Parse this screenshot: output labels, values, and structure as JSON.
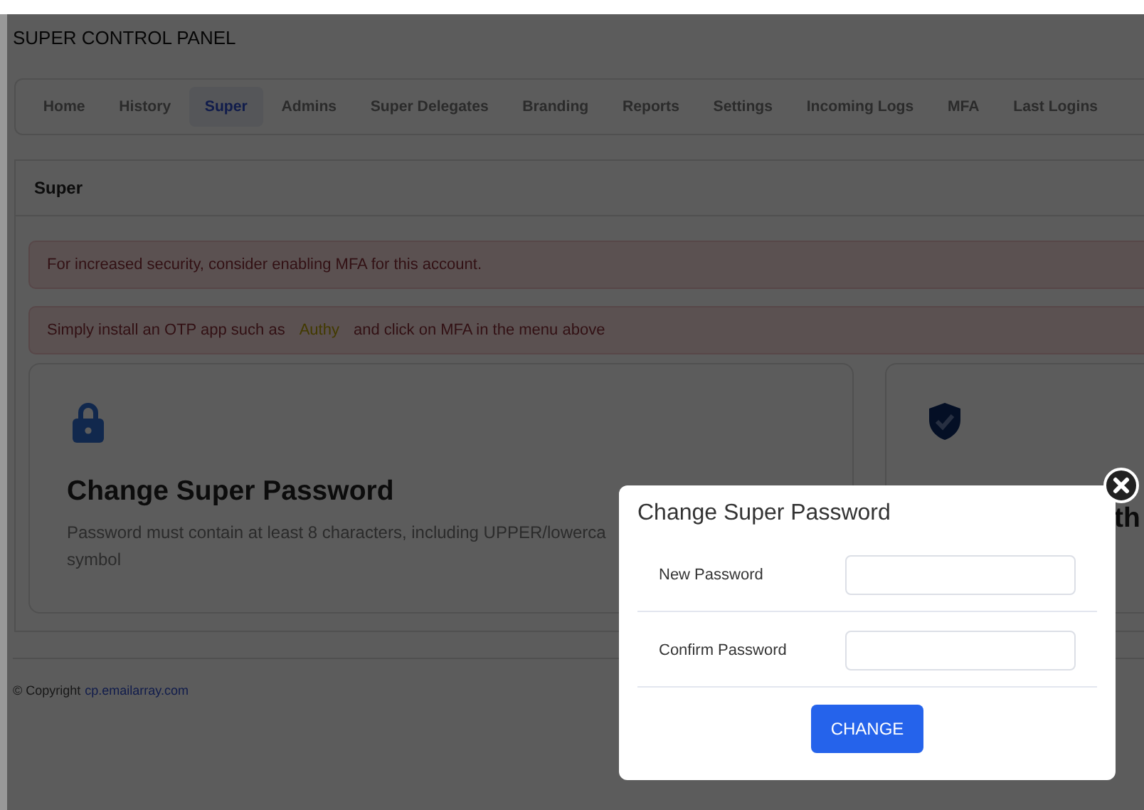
{
  "header": {
    "title": "SUPER CONTROL PANEL"
  },
  "tabs": [
    {
      "label": "Home",
      "selected": false
    },
    {
      "label": "History",
      "selected": false
    },
    {
      "label": "Super",
      "selected": true
    },
    {
      "label": "Admins",
      "selected": false
    },
    {
      "label": "Super Delegates",
      "selected": false
    },
    {
      "label": "Branding",
      "selected": false
    },
    {
      "label": "Reports",
      "selected": false
    },
    {
      "label": "Settings",
      "selected": false
    },
    {
      "label": "Incoming Logs",
      "selected": false
    },
    {
      "label": "MFA",
      "selected": false
    },
    {
      "label": "Last Logins",
      "selected": false
    }
  ],
  "panel": {
    "title": "Super",
    "alerts": [
      {
        "text": "For increased security, consider enabling MFA for this account."
      },
      {
        "text": "Simply install an OTP app such as",
        "link": "Authy",
        "text_after": "and click on MFA in the menu above"
      }
    ],
    "cards": [
      {
        "kind": "lock",
        "title": "Change Super Password",
        "lines": [
          "Password must contain at least 8 characters, including UPPER/lowerca",
          "symbol"
        ]
      },
      {
        "kind": "shield",
        "title": "th"
      }
    ]
  },
  "footer": {
    "text": "© Copyright",
    "link": "cp.emailarray.com"
  },
  "modal": {
    "title": "Change Super Password",
    "fields": [
      {
        "label": "New Password"
      },
      {
        "label": "Confirm Password"
      }
    ],
    "button": "CHANGE"
  }
}
